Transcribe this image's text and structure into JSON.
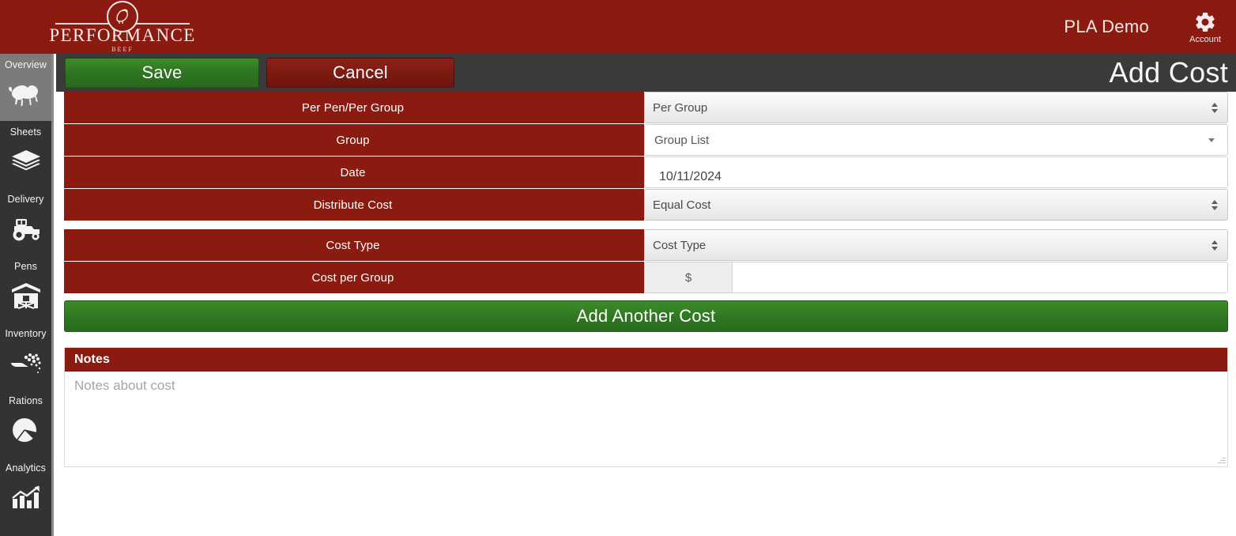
{
  "header": {
    "brand_name": "PERFORMANCE",
    "brand_sub": "BEEF",
    "brand_logo_icon": "cow-monogram-icon",
    "user": "PLA Demo",
    "account_label": "Account",
    "account_icon": "gear-icon",
    "background_color": "#8b1a10"
  },
  "sidebar": {
    "background_color": "#333333",
    "active_background_color": "#7b7b7b",
    "items": [
      {
        "label": "Overview",
        "icon": "cow-icon",
        "active": true
      },
      {
        "label": "Sheets",
        "icon": "layers-icon",
        "active": false
      },
      {
        "label": "Delivery",
        "icon": "tractor-icon",
        "active": false
      },
      {
        "label": "Pens",
        "icon": "barn-icon",
        "active": false
      },
      {
        "label": "Inventory",
        "icon": "hand-feed-icon",
        "active": false
      },
      {
        "label": "Rations",
        "icon": "pie-chart-icon",
        "active": false
      },
      {
        "label": "Analytics",
        "icon": "bar-chart-up-icon",
        "active": false
      }
    ]
  },
  "toolbar": {
    "save_label": "Save",
    "cancel_label": "Cancel",
    "page_title": "Add Cost",
    "background_color": "#3a3a3a",
    "save_color": "#2e7321",
    "cancel_color": "#7d1a12"
  },
  "form": {
    "rows": [
      {
        "label": "Per Pen/Per Group",
        "control": "select",
        "value": "Per Group",
        "icon": "spinner-arrows-icon"
      },
      {
        "label": "Group",
        "control": "dropdown",
        "value": "Group List",
        "icon": "chevron-down-icon"
      },
      {
        "label": "Date",
        "control": "text",
        "value": "10/11/2024"
      },
      {
        "label": "Distribute Cost",
        "control": "select",
        "value": "Equal Cost",
        "icon": "spinner-arrows-icon"
      }
    ],
    "rows2": [
      {
        "label": "Cost Type",
        "control": "select",
        "value": "Cost Type",
        "icon": "spinner-arrows-icon"
      },
      {
        "label": "Cost per Group",
        "control": "money",
        "prefix": "$",
        "value": ""
      }
    ],
    "add_another_label": "Add Another Cost",
    "label_background_color": "#8b1a10"
  },
  "notes": {
    "title": "Notes",
    "placeholder": "Notes about cost",
    "value": "",
    "resize_handle_icon": "resize-grip-icon"
  }
}
